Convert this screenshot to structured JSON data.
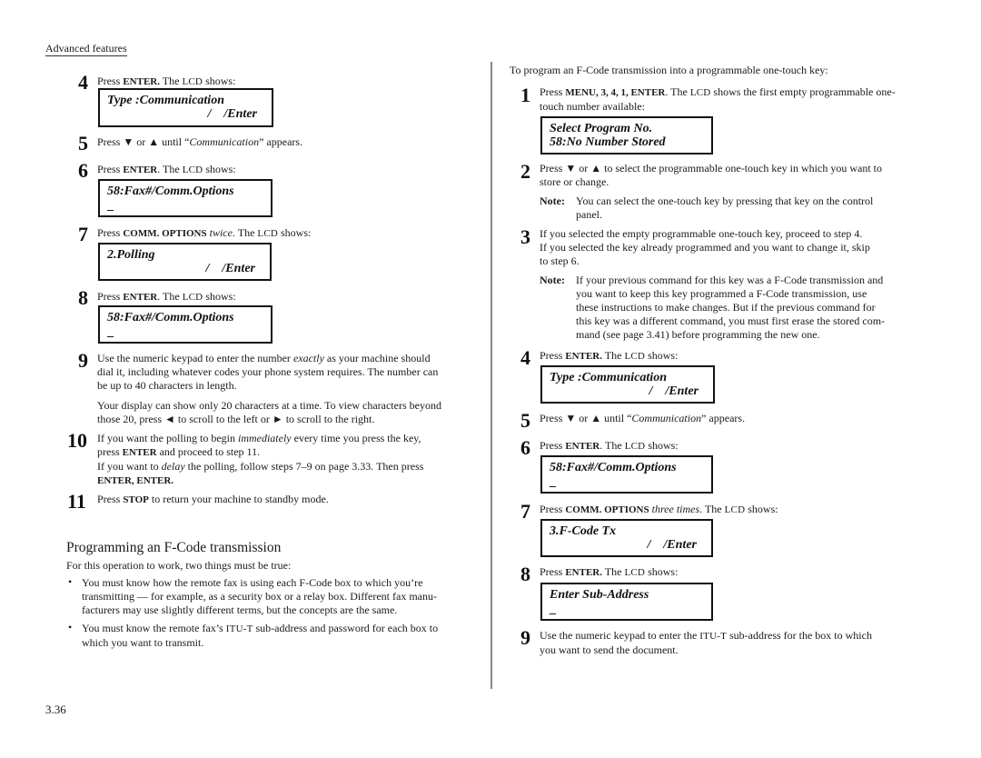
{
  "header": {
    "section": "Advanced features"
  },
  "page_number": "3.36",
  "left": {
    "steps": [
      {
        "num": "4",
        "pre": "Press ",
        "key": "ENTER.",
        "post": " The ",
        "lcd_word": "LCD",
        "post2": " shows:"
      },
      {
        "num": "5",
        "text_a": "Press ▼ or ▲ until “",
        "text_i": "Communication",
        "text_b": "” appears."
      },
      {
        "num": "6",
        "pre": "Press ",
        "key": "ENTER",
        "post": ". The ",
        "lcd_word": "LCD",
        "post2": " shows:"
      },
      {
        "num": "7",
        "pre": "Press ",
        "key": "COMM. OPTIONS",
        "italic": " twice",
        "post": ". The ",
        "lcd_word": "LCD",
        "post2": " shows:"
      },
      {
        "num": "8",
        "pre": "Press ",
        "key": "ENTER",
        "post": ". The ",
        "lcd_word": "LCD",
        "post2": " shows:"
      },
      {
        "num": "9",
        "line1_a": "Use the numeric keypad to enter the number ",
        "line1_i": "exactly",
        "line1_b": " as your machine should",
        "line2": "dial it, including whatever codes your phone system requires. The number can",
        "line3": "be up to 40 characters in length.",
        "para2_line1": "Your display can show only 20 characters at a time. To view characters beyond",
        "para2_line2": "those 20, press ◄ to scroll to the left or ► to scroll to the right."
      },
      {
        "num": "10",
        "line1_a": "If you want the polling to begin ",
        "line1_i": "immediately",
        "line1_b": " every time you press the key,",
        "line2_a": "press ",
        "line2_key": "ENTER",
        "line2_b": " and proceed to step 11.",
        "line3_a": "If you want to ",
        "line3_i": "delay",
        "line3_b": " the polling, follow steps 7–9 on page 3.33. Then press",
        "line4_key": "ENTER, ENTER."
      },
      {
        "num": "11",
        "pre": "Press ",
        "key": "STOP",
        "post": " to return your machine to standby mode."
      }
    ],
    "lcds": [
      {
        "line1": "Type :Communication",
        "line2": "/    /Enter"
      },
      {
        "line1": "58:Fax#/Comm.Options",
        "line2": "_"
      },
      {
        "line1": "2.Polling",
        "line2": "/    /Enter"
      },
      {
        "line1": "58:Fax#/Comm.Options",
        "line2": "_"
      }
    ],
    "section_title": "Programming an F-Code transmission",
    "intro": "For this operation to work, two things must be true:",
    "bullets": [
      {
        "lines": [
          "You must know how the remote fax is using each F-Code box to which you’re",
          "transmitting — for example, as a security box or a relay box. Different fax manu-",
          "facturers may use slightly different terms, but the concepts are the same."
        ]
      },
      {
        "line1_a": "You must know the remote fax’s ",
        "line1_sc": "ITU-T",
        "line1_b": " sub-address and password for each box to",
        "line2": "which you want to transmit."
      }
    ],
    "bullet_glyph": "•"
  },
  "right": {
    "intro": "To program an F-Code transmission into a programmable one-touch key:",
    "steps": [
      {
        "num": "1",
        "pre": "Press ",
        "key": "MENU, 3, 4, 1, ENTER",
        "post": ". The ",
        "lcd_word": "LCD",
        "post2": " shows the first empty programmable one-",
        "line2": "touch number available:"
      },
      {
        "num": "2",
        "line1": "Press ▼ or ▲ to select the programmable one-touch key in which you want to",
        "line2": "store or change.",
        "note_label": "Note:",
        "note_lines": [
          "You can select the one-touch key by pressing that key on the control",
          "panel."
        ]
      },
      {
        "num": "3",
        "line1": "If you selected the empty programmable one-touch key, proceed to step 4.",
        "line2": "If you selected the key already programmed and you want to change it, skip",
        "line3": "to step 6.",
        "note_label": "Note:",
        "note_lines": [
          "If your previous command for this key was a F-Code transmission and",
          "you want to keep this key programmed a F-Code transmission, use",
          "these instructions to make changes. But if the previous command for",
          "this key was a different command, you must first erase the stored com-",
          "mand (see page 3.41) before programming the new one."
        ]
      },
      {
        "num": "4",
        "pre": "Press ",
        "key": "ENTER.",
        "post": " The ",
        "lcd_word": "LCD",
        "post2": " shows:"
      },
      {
        "num": "5",
        "text_a": "Press ▼ or ▲ until “",
        "text_i": "Communication",
        "text_b": "” appears."
      },
      {
        "num": "6",
        "pre": "Press ",
        "key": "ENTER",
        "post": ". The ",
        "lcd_word": "LCD",
        "post2": " shows:"
      },
      {
        "num": "7",
        "pre": "Press ",
        "key": "COMM. OPTIONS",
        "italic": " three times",
        "post": ". The ",
        "lcd_word": "LCD",
        "post2": " shows:"
      },
      {
        "num": "8",
        "pre": "Press ",
        "key": "ENTER.",
        "post": " The ",
        "lcd_word": "LCD",
        "post2": " shows:"
      },
      {
        "num": "9",
        "line1_a": "Use the numeric keypad to enter the ",
        "line1_sc": "ITU-T",
        "line1_b": " sub-address for the box to which",
        "line2": "you want to send the document."
      }
    ],
    "lcds": [
      {
        "line1": "Select Program No.",
        "line2": "58:No Number Stored"
      },
      {
        "line1": "Type :Communication",
        "line2": "/    /Enter"
      },
      {
        "line1": "58:Fax#/Comm.Options",
        "line2": "_"
      },
      {
        "line1": "3.F-Code Tx",
        "line2": "/    /Enter"
      },
      {
        "line1": "Enter Sub-Address",
        "line2": "_"
      }
    ]
  }
}
